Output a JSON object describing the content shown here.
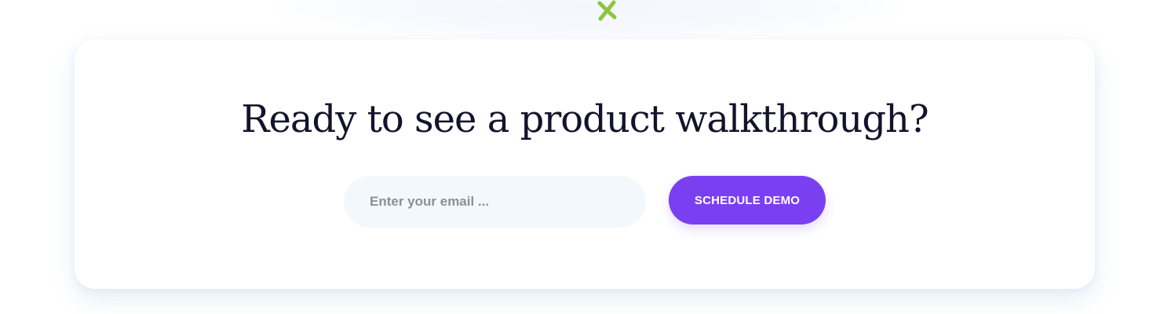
{
  "cta": {
    "heading": "Ready to see a product walkthrough?",
    "email_placeholder": "Enter your email ...",
    "email_value": "",
    "button_label": "SCHEDULE DEMO"
  },
  "colors": {
    "heading": "#15132b",
    "button_background": "#7b3ff2",
    "button_text": "#ffffff",
    "input_background": "#f3f8fc",
    "decoration": "#8cc63f"
  },
  "icons": {
    "decoration": "cross-sparkle-icon"
  }
}
